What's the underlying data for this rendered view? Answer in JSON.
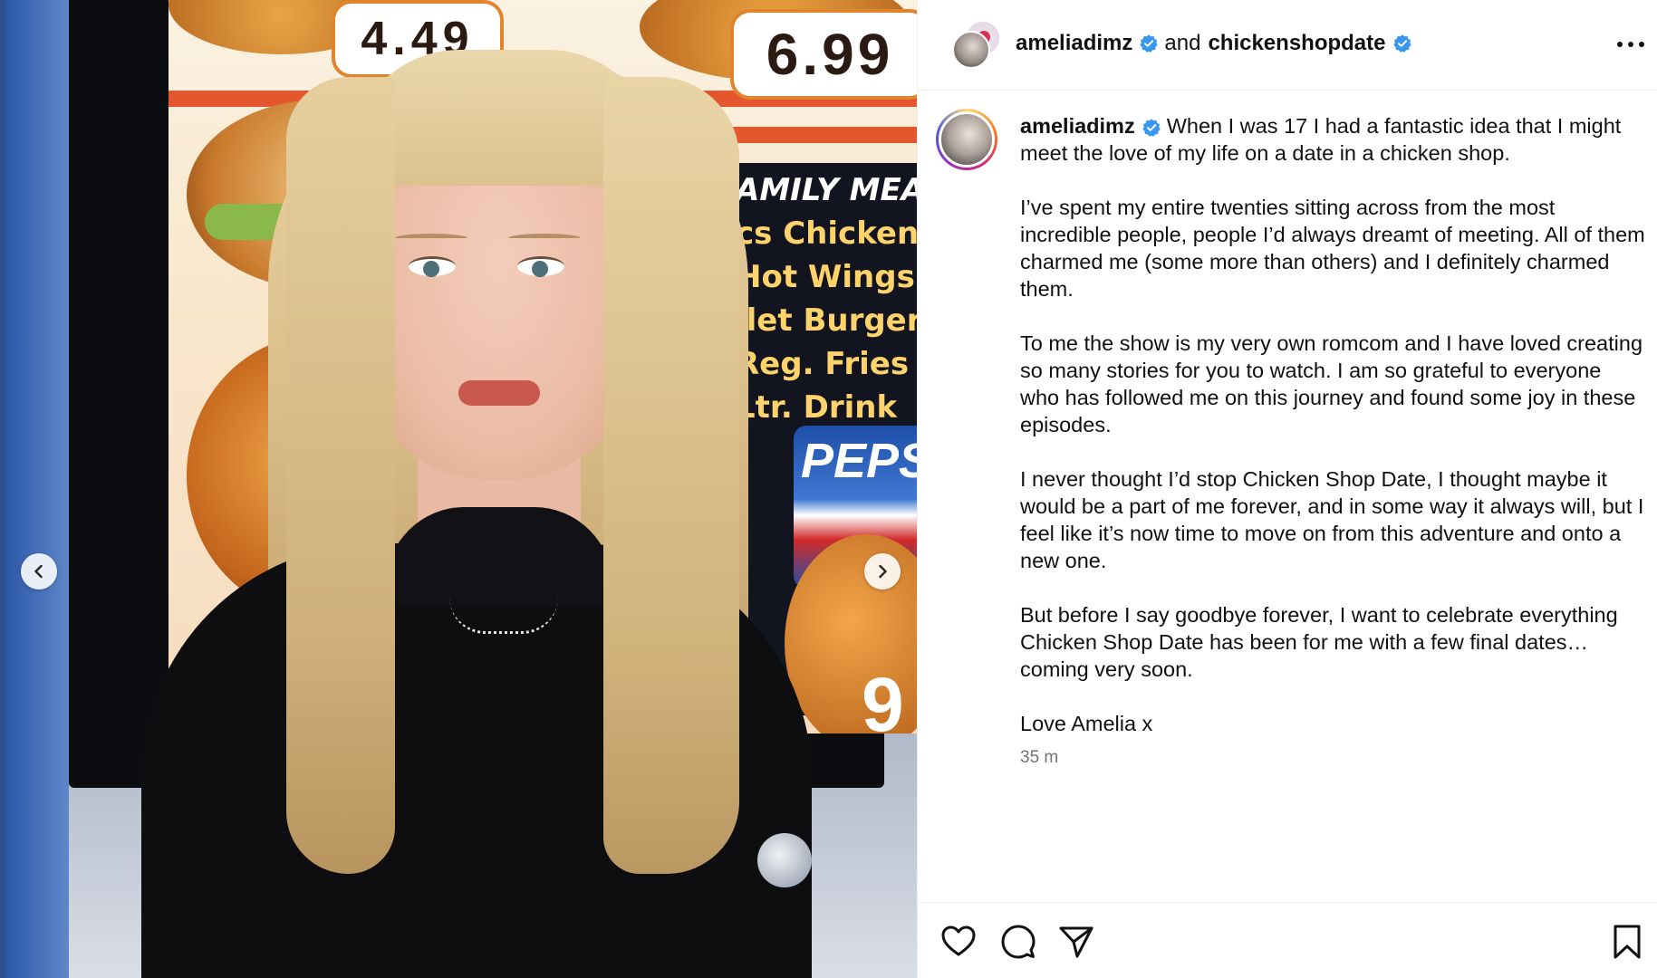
{
  "media": {
    "menu": {
      "price_1": "4.49",
      "price_2": "6.99",
      "meal_lines": [
        "AMILY MEAL",
        "cs Chicken",
        "Hot Wings",
        "llet Burger",
        "Reg. Fries",
        "Ltr. Drink"
      ],
      "pepsi": "PEPS",
      "price_fragment": "9"
    },
    "prev_icon": "chevron-left-icon",
    "next_icon": "chevron-right-icon"
  },
  "header": {
    "user_1": "ameliadimz",
    "connector": "and",
    "user_2": "chickenshopdate",
    "more_icon": "more-options-icon"
  },
  "caption": {
    "username": "ameliadimz",
    "paragraphs": [
      "When I was 17 I had a fantastic idea that I might meet the love of my life on a date in a chicken shop.",
      "I’ve spent my entire twenties sitting across from the most incredible people, people I’d always dreamt of meeting. All of them charmed me (some more than others) and I definitely charmed them.",
      "To me the show is my very own romcom and I have loved creating so many stories for you to watch. I am so grateful to everyone who has followed me on this journey and found some joy in these episodes.",
      "I never thought I’d stop Chicken Shop Date, I thought maybe it would be a part of me forever, and in some way it always will, but I feel like it’s now time to move on from this adventure and onto a new one.",
      "But before I say goodbye forever, I want to celebrate everything Chicken Shop Date has been for me with a few final dates…coming very soon.",
      "Love Amelia x"
    ],
    "timestamp": "35 m"
  },
  "actions": {
    "like_icon": "heart-icon",
    "comment_icon": "comment-icon",
    "share_icon": "share-icon",
    "save_icon": "bookmark-icon"
  },
  "colors": {
    "verified": "#3897f0",
    "text": "#111111",
    "muted": "#737373",
    "divider": "#efefef"
  }
}
